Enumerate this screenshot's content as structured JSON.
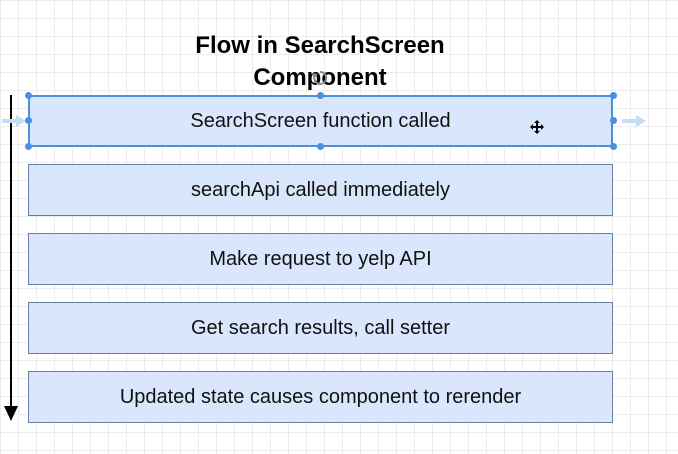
{
  "diagram": {
    "title_line1": "Flow in SearchScreen",
    "title_line2": "Component",
    "steps": [
      "SearchScreen function called",
      "searchApi called immediately",
      "Make request to yelp API",
      "Get search results, call setter",
      "Updated state causes component to rerender"
    ],
    "selected_step": 0,
    "colors": {
      "box_fill": "#d9e6fb",
      "box_border": "#6a7fa6",
      "selection": "#4b90e0",
      "arrow": "#000000"
    }
  }
}
